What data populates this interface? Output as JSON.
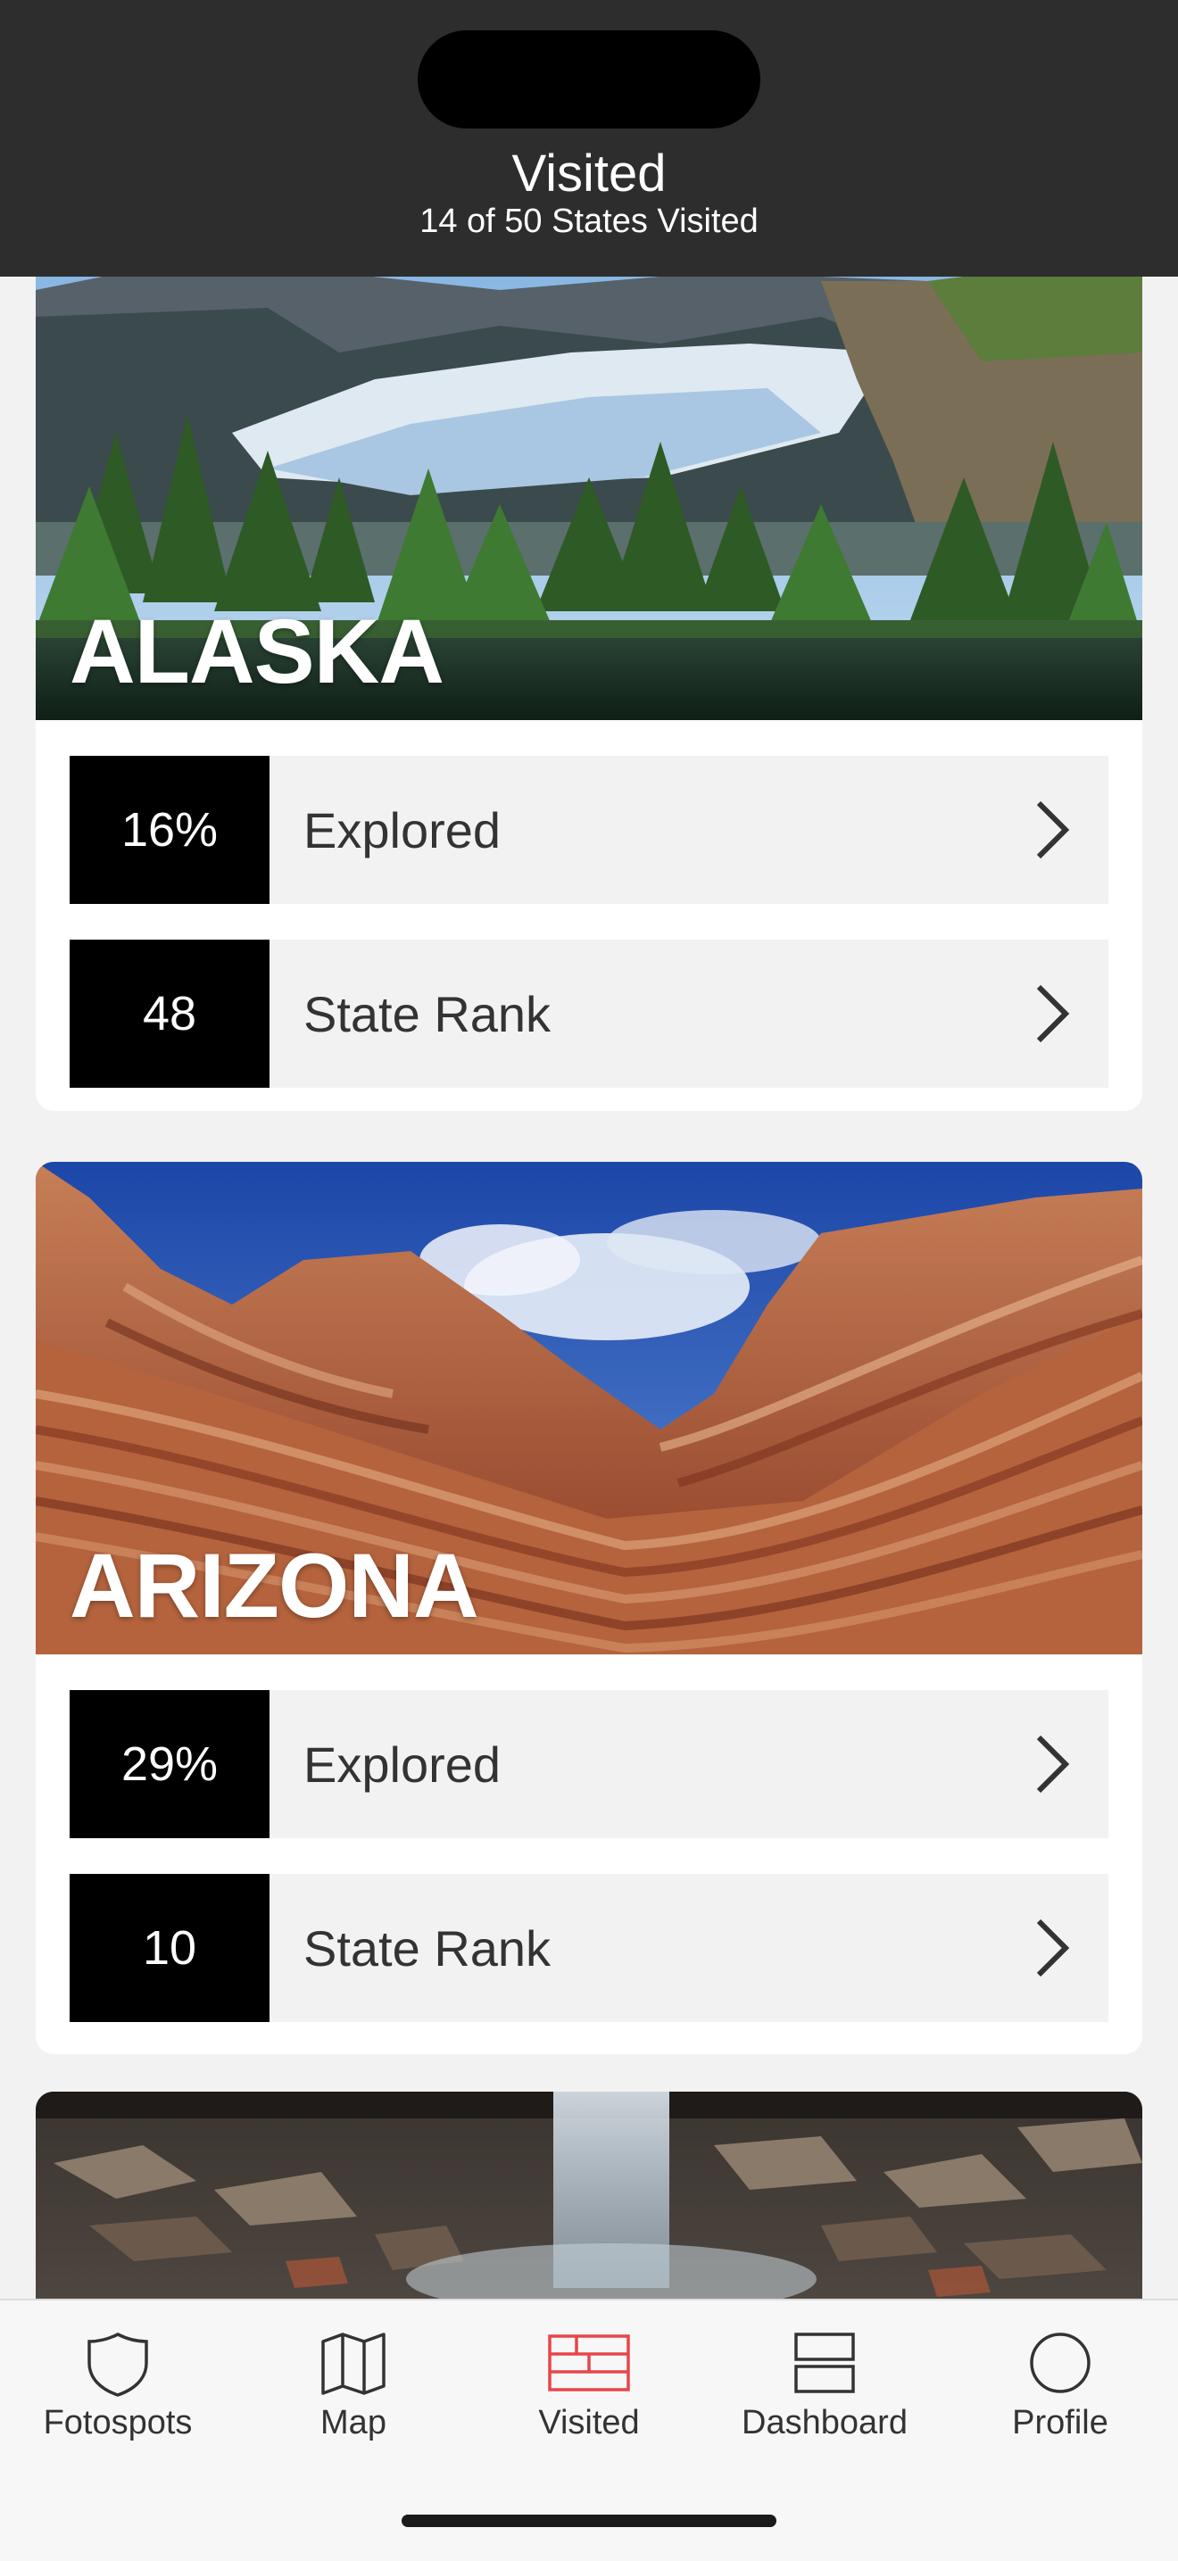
{
  "header": {
    "title": "Visited",
    "subtitle": "14 of 50 States Visited"
  },
  "cards": [
    {
      "state": "ALASKA",
      "stats": [
        {
          "value": "16%",
          "label": "Explored"
        },
        {
          "value": "48",
          "label": "State Rank"
        }
      ]
    },
    {
      "state": "ARIZONA",
      "stats": [
        {
          "value": "29%",
          "label": "Explored"
        },
        {
          "value": "10",
          "label": "State Rank"
        }
      ]
    }
  ],
  "tabs": [
    {
      "label": "Fotospots",
      "icon": "shield-icon"
    },
    {
      "label": "Map",
      "icon": "map-icon"
    },
    {
      "label": "Visited",
      "icon": "visited-icon",
      "active": true
    },
    {
      "label": "Dashboard",
      "icon": "dashboard-icon"
    },
    {
      "label": "Profile",
      "icon": "profile-icon"
    }
  ],
  "colors": {
    "header_bg": "#2d2d2d",
    "accent": "#e8454a",
    "stat_bg": "#000000",
    "row_bg": "#f2f2f2"
  }
}
